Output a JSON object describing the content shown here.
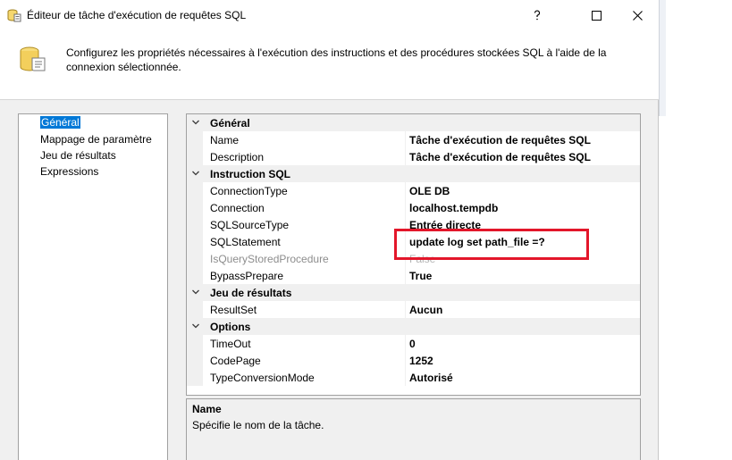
{
  "window": {
    "title": "Éditeur de tâche d'exécution de requêtes SQL",
    "icons": {
      "app": "sql-task-icon",
      "help": "help-icon",
      "maximize": "maximize-icon",
      "close": "close-icon"
    }
  },
  "header": {
    "description": "Configurez les propriétés nécessaires à l'exécution des instructions et des procédures stockées SQL à l'aide de la connexion sélectionnée.",
    "icon": "database-scroll-icon"
  },
  "nav": {
    "items": [
      {
        "label": "Général",
        "selected": true
      },
      {
        "label": "Mappage de paramètre",
        "selected": false
      },
      {
        "label": "Jeu de résultats",
        "selected": false
      },
      {
        "label": "Expressions",
        "selected": false
      }
    ],
    "selected_color": "#0078d7"
  },
  "grid": {
    "categories": [
      {
        "label": "Général",
        "properties": [
          {
            "name": "Name",
            "value": "Tâche d'exécution de requêtes SQL"
          },
          {
            "name": "Description",
            "value": "Tâche d'exécution de requêtes SQL"
          }
        ]
      },
      {
        "label": "Instruction SQL",
        "properties": [
          {
            "name": "ConnectionType",
            "value": "OLE DB"
          },
          {
            "name": "Connection",
            "value": "localhost.tempdb"
          },
          {
            "name": "SQLSourceType",
            "value": "Entrée directe"
          },
          {
            "name": "SQLStatement",
            "value": "update log set path_file =?"
          },
          {
            "name": "IsQueryStoredProcedure",
            "value": "False",
            "disabled": true
          },
          {
            "name": "BypassPrepare",
            "value": "True"
          }
        ]
      },
      {
        "label": "Jeu de résultats",
        "properties": [
          {
            "name": "ResultSet",
            "value": "Aucun"
          }
        ]
      },
      {
        "label": "Options",
        "properties": [
          {
            "name": "TimeOut",
            "value": "0"
          },
          {
            "name": "CodePage",
            "value": "1252"
          },
          {
            "name": "TypeConversionMode",
            "value": "Autorisé"
          }
        ]
      }
    ],
    "highlight_color": "#e3162a"
  },
  "description_panel": {
    "title": "Name",
    "text": "Spécifie le nom de la tâche."
  }
}
